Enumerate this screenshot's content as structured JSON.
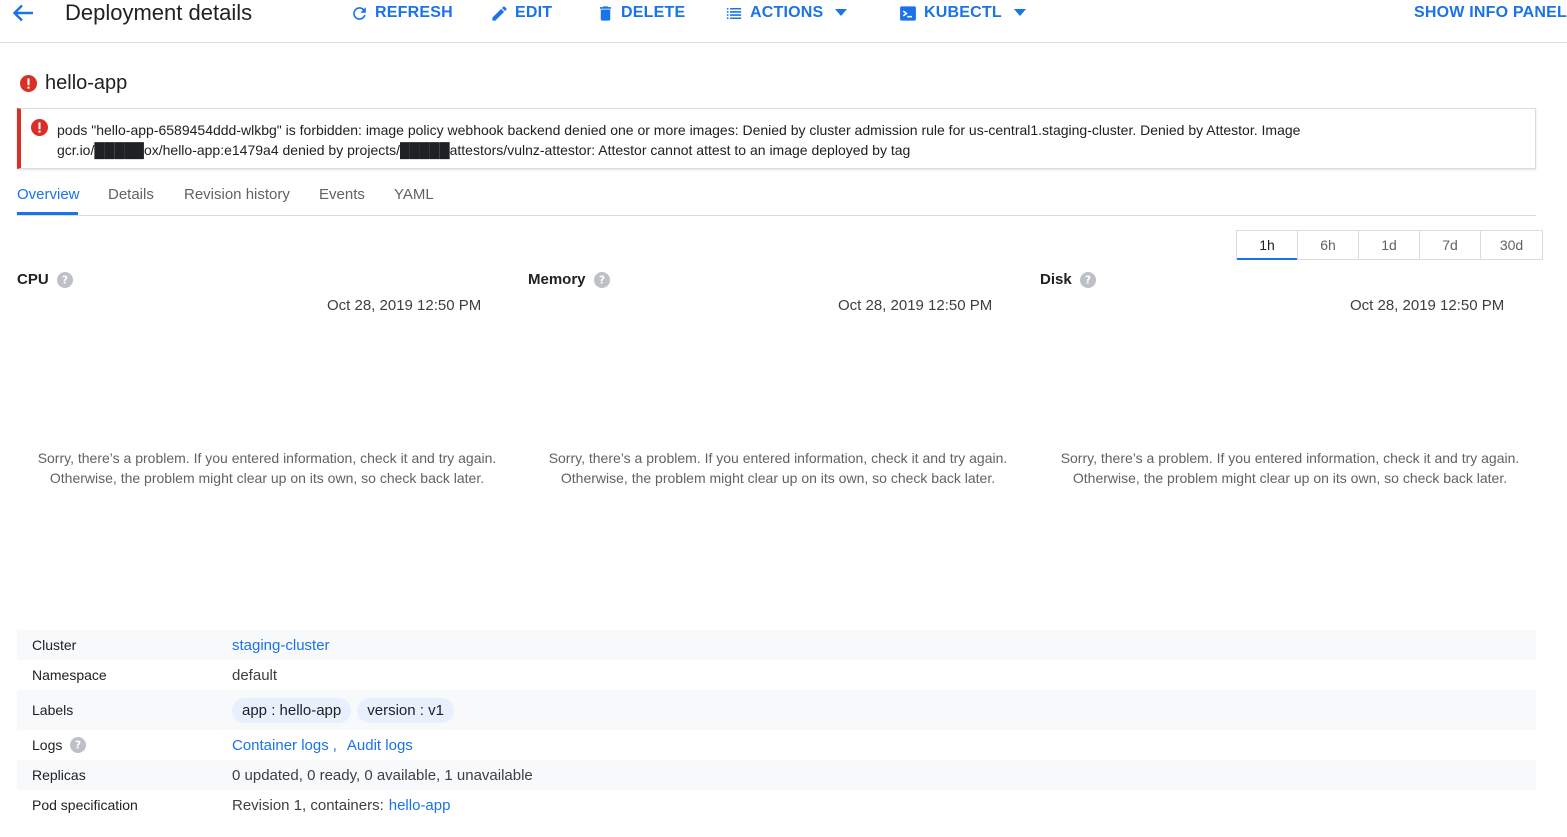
{
  "toolbar": {
    "title": "Deployment details",
    "refresh_label": "REFRESH",
    "edit_label": "EDIT",
    "delete_label": "DELETE",
    "actions_label": "ACTIONS",
    "kubectl_label": "KUBECTL",
    "info_panel_label": "SHOW INFO PANEL"
  },
  "resource": {
    "name": "hello-app",
    "error_line1": "pods \"hello-app-6589454ddd-wlkbg\" is forbidden: image policy webhook backend denied one or more images: Denied by cluster admission rule for us-central1.staging-cluster. Denied by Attestor. Image",
    "error_line2": "gcr.io/█████ox/hello-app:e1479a4 denied by projects/█████attestors/vulnz-attestor: Attestor cannot attest to an image deployed by tag"
  },
  "tabs": [
    {
      "label": "Overview"
    },
    {
      "label": "Details"
    },
    {
      "label": "Revision history"
    },
    {
      "label": "Events"
    },
    {
      "label": "YAML"
    }
  ],
  "time_range": {
    "options": [
      "1h",
      "6h",
      "1d",
      "7d",
      "30d"
    ],
    "selected": "1h"
  },
  "charts": [
    {
      "title": "CPU",
      "timestamp": "Oct 28, 2019 12:50 PM",
      "error_line1": "Sorry, there’s a problem. If you entered information, check it and try again.",
      "error_line2": "Otherwise, the problem might clear up on its own, so check back later."
    },
    {
      "title": "Memory",
      "timestamp": "Oct 28, 2019 12:50 PM",
      "error_line1": "Sorry, there’s a problem. If you entered information, check it and try again.",
      "error_line2": "Otherwise, the problem might clear up on its own, so check back later."
    },
    {
      "title": "Disk",
      "timestamp": "Oct 28, 2019 12:50 PM",
      "error_line1": "Sorry, there’s a problem. If you entered information, check it and try again.",
      "error_line2": "Otherwise, the problem might clear up on its own, so check back later."
    }
  ],
  "details": {
    "cluster_key": "Cluster",
    "cluster_value": "staging-cluster",
    "namespace_key": "Namespace",
    "namespace_value": "default",
    "labels_key": "Labels",
    "labels": [
      "app : hello-app",
      "version : v1"
    ],
    "logs_key": "Logs",
    "container_logs": "Container logs",
    "logs_separator": ",",
    "audit_logs": "Audit logs",
    "replicas_key": "Replicas",
    "replicas_value": "0 updated, 0 ready, 0 available, 1 unavailable",
    "podspec_key": "Pod specification",
    "podspec_prefix": "Revision 1, containers:",
    "podspec_link": "hello-app"
  },
  "colors": {
    "accent": "#1a73e8",
    "error": "#d93025",
    "help_icon": "#bdc1c6"
  }
}
